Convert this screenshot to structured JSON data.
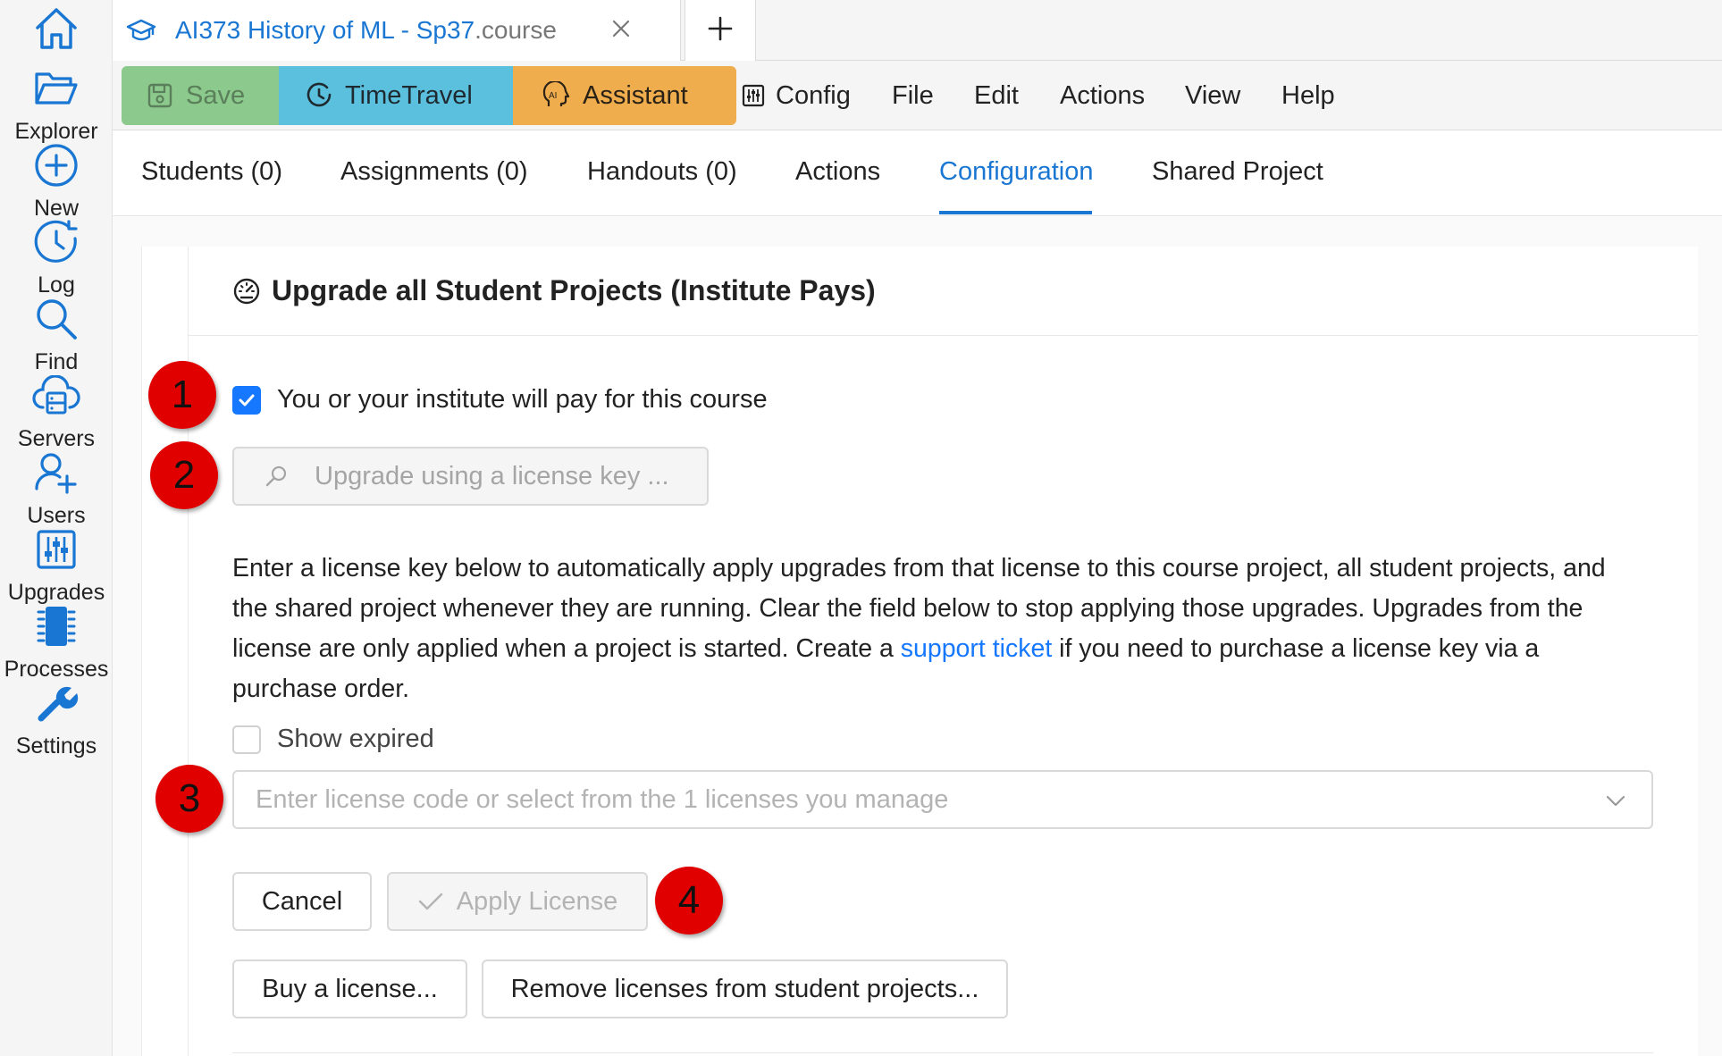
{
  "file_tab": {
    "name": "AI373 History of ML - Sp37",
    "ext": ".course"
  },
  "sidebar": {
    "items": [
      {
        "label": "Explorer"
      },
      {
        "label": "New"
      },
      {
        "label": "Log"
      },
      {
        "label": "Find"
      },
      {
        "label": "Servers"
      },
      {
        "label": "Users"
      },
      {
        "label": "Upgrades"
      },
      {
        "label": "Processes"
      },
      {
        "label": "Settings"
      }
    ]
  },
  "toolbar": {
    "save": "Save",
    "timetravel": "TimeTravel",
    "assistant": "Assistant",
    "menu": [
      "Config",
      "File",
      "Edit",
      "Actions",
      "View",
      "Help"
    ]
  },
  "subtabs": [
    "Students (0)",
    "Assignments (0)",
    "Handouts (0)",
    "Actions",
    "Configuration",
    "Shared Project"
  ],
  "active_subtab": "Configuration",
  "card": {
    "title": "Upgrade all Student Projects (Institute Pays)",
    "pay_checkbox_label": "You or your institute will pay for this course",
    "pay_checked": true,
    "license_key_button": "Upgrade using a license key  ...",
    "paragraph_part1": "Enter a license key below to automatically apply upgrades from that license to this course project, all student projects, and the shared project whenever they are running. Clear the field below to stop applying those upgrades. Upgrades from the license are only applied when a project is started. Create a ",
    "support_link": "support ticket",
    "paragraph_part2": " if you need to purchase a license key via a purchase order.",
    "show_expired_label": "Show expired",
    "show_expired_checked": false,
    "select_placeholder": "Enter license code or select from the 1 licenses you manage",
    "cancel": "Cancel",
    "apply_license": "Apply License",
    "buy_license": "Buy a license...",
    "remove_licenses": "Remove licenses from student projects..."
  },
  "markers": [
    "1",
    "2",
    "3",
    "4"
  ],
  "colors": {
    "accent": "#1976d2",
    "marker": "#e00000",
    "save_bg": "#8cc98c",
    "timetravel_bg": "#5bc0de",
    "assistant_bg": "#f0ad4e",
    "checkbox": "#1677ff"
  }
}
